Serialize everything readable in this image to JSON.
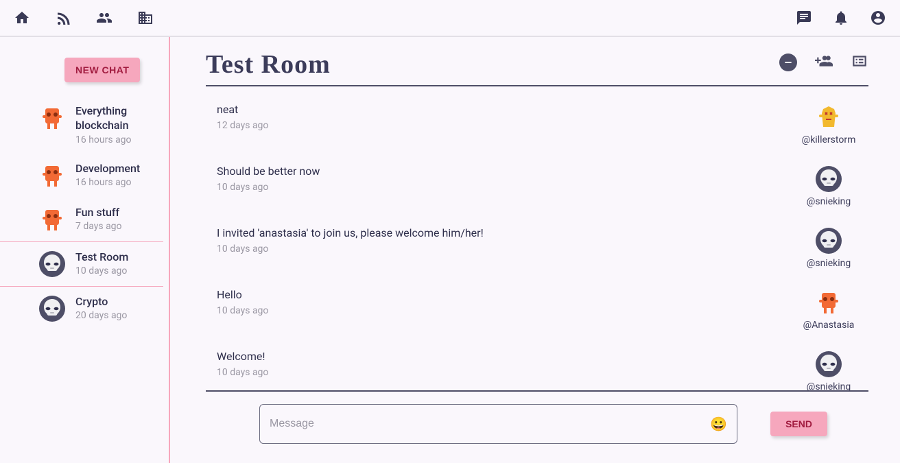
{
  "sidebar": {
    "new_chat_label": "NEW CHAT",
    "chats": [
      {
        "title": "Everything blockchain",
        "time": "16 hours ago",
        "avatar": "robot-orange"
      },
      {
        "title": "Development",
        "time": "16 hours ago",
        "avatar": "robot-orange"
      },
      {
        "title": "Fun stuff",
        "time": "7 days ago",
        "avatar": "robot-orange"
      },
      {
        "title": "Test Room",
        "time": "10 days ago",
        "avatar": "trooper",
        "selected": true
      },
      {
        "title": "Crypto",
        "time": "20 days ago",
        "avatar": "trooper"
      }
    ]
  },
  "room": {
    "title": "Test Room",
    "messages": [
      {
        "text": "neat",
        "time": "12 days ago",
        "author": "@killerstorm",
        "avatar": "vest-yellow"
      },
      {
        "text": "Should be better now",
        "time": "10 days ago",
        "author": "@snieking",
        "avatar": "trooper"
      },
      {
        "text": "I invited 'anastasia' to join us, please welcome him/her!",
        "time": "10 days ago",
        "author": "@snieking",
        "avatar": "trooper"
      },
      {
        "text": "Hello",
        "time": "10 days ago",
        "author": "@Anastasia",
        "avatar": "robot-orange"
      },
      {
        "text": "Welcome!",
        "time": "10 days ago",
        "author": "@snieking",
        "avatar": "trooper"
      }
    ]
  },
  "composer": {
    "placeholder": "Message",
    "send_label": "SEND"
  }
}
